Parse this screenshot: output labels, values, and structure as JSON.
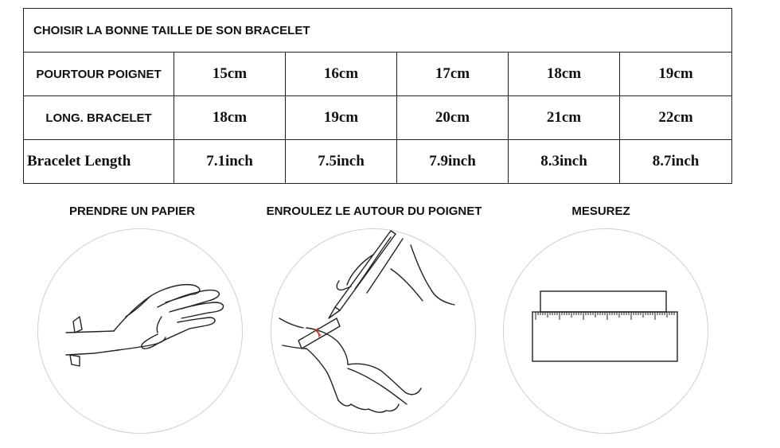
{
  "table": {
    "title": "CHOISIR LA BONNE TAILLE DE SON BRACELET",
    "rows": [
      {
        "label": "POURTOUR POIGNET",
        "values": [
          "15cm",
          "16cm",
          "17cm",
          "18cm",
          "19cm"
        ]
      },
      {
        "label": "LONG. BRACELET",
        "values": [
          "18cm",
          "19cm",
          "20cm",
          "21cm",
          "22cm"
        ]
      },
      {
        "label": "Bracelet Length",
        "values": [
          "7.1inch",
          "7.5inch",
          "7.9inch",
          "8.3inch",
          "8.7inch"
        ]
      }
    ]
  },
  "steps": [
    {
      "title": "PRENDRE UN PAPIER",
      "icon": "hand-paper-icon"
    },
    {
      "title": "ENROULEZ LE AUTOUR DU POIGNET",
      "icon": "wrap-wrist-icon"
    },
    {
      "title": "MESUREZ",
      "icon": "ruler-icon"
    }
  ],
  "colors": {
    "marker": "#c0392b",
    "circle_border": "#cfcfcf"
  }
}
